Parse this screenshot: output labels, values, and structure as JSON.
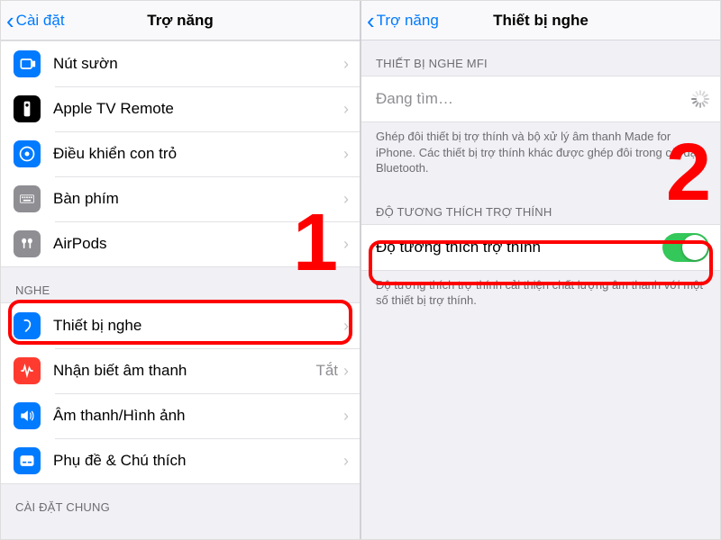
{
  "left": {
    "back": "Cài đặt",
    "title": "Trợ năng",
    "group1": [
      {
        "label": "Nút sườn"
      },
      {
        "label": "Apple TV Remote"
      },
      {
        "label": "Điều khiển con trỏ"
      },
      {
        "label": "Bàn phím"
      },
      {
        "label": "AirPods"
      }
    ],
    "section_nghe": "NGHE",
    "group_nghe": [
      {
        "label": "Thiết bị nghe"
      },
      {
        "label": "Nhận biết âm thanh",
        "detail": "Tắt"
      },
      {
        "label": "Âm thanh/Hình ảnh"
      },
      {
        "label": "Phụ đề & Chú thích"
      }
    ],
    "section_chung": "CÀI ĐẶT CHUNG"
  },
  "right": {
    "back": "Trợ năng",
    "title": "Thiết bị nghe",
    "section_mfi": "THIẾT BỊ NGHE MFI",
    "searching": "Đang tìm…",
    "mfi_footer": "Ghép đôi thiết bị trợ thính và bộ xử lý âm thanh Made for iPhone. Các thiết bị trợ thính khác được ghép đôi trong cài đặt Bluetooth.",
    "section_compat": "ĐỘ TƯƠNG THÍCH TRỢ THÍNH",
    "compat_label": "Độ tương thích trợ thính",
    "compat_footer": "Độ tương thích trợ thính cải thiện chất lượng âm thanh với một số thiết bị trợ thính."
  },
  "annot": {
    "num1": "1",
    "num2": "2"
  }
}
